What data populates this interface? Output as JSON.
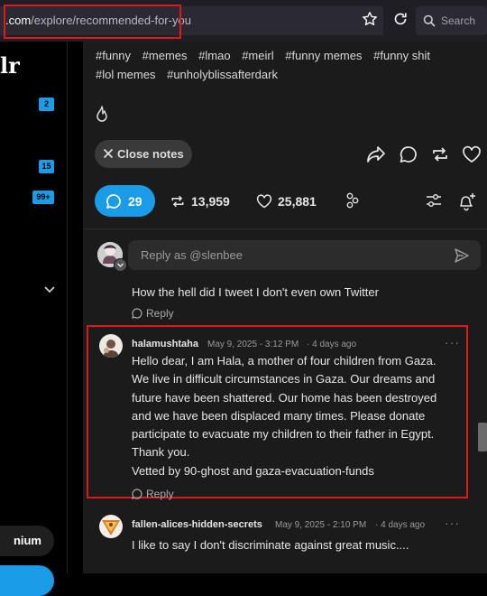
{
  "browser": {
    "url_prefix": ".com",
    "url_path": "/explore/recommended-for-you",
    "search_placeholder": "Search"
  },
  "sidebar": {
    "logo_fragment": "lr",
    "badges": [
      "2",
      "15",
      "99+"
    ],
    "premium_label": "nium"
  },
  "post": {
    "tags": [
      "#funny",
      "#memes",
      "#lmao",
      "#meirl",
      "#funny memes",
      "#funny shit",
      "#lol memes",
      "#unholyblissafterdark"
    ],
    "close_notes_label": "Close notes",
    "notes_count": "29",
    "reblogs": "13,959",
    "likes": "25,881"
  },
  "reply": {
    "placeholder": "Reply as @slenbee"
  },
  "comments": [
    {
      "text": "How the hell did I tweet I don't even own Twitter",
      "reply_label": "Reply"
    },
    {
      "username": "halamushtaha",
      "date": "May 9, 2025 - 3:12 PM",
      "ago": "· 4 days ago",
      "more": "···",
      "lines": [
        "Hello dear, I am Hala, a mother of four children from Gaza.",
        "We live in difficult circumstances in Gaza. Our dreams and",
        "future have been shattered. Our home has been destroyed",
        "and we have been displaced many times. Please donate",
        "participate to evacuate my children to their father in Egypt.",
        "Thank you.",
        "Vetted by 90-ghost and gaza-evacuation-funds"
      ],
      "reply_label": "Reply"
    },
    {
      "username": "fallen-alices-hidden-secrets",
      "date": "May 9, 2025 - 2:10 PM",
      "ago": "· 4 days ago",
      "more": "···",
      "text": "I like to say I don't discriminate against great music...."
    }
  ],
  "colors": {
    "accent": "#1a9ce9",
    "highlight": "#e0181d",
    "panel": "#1b1b1b"
  }
}
